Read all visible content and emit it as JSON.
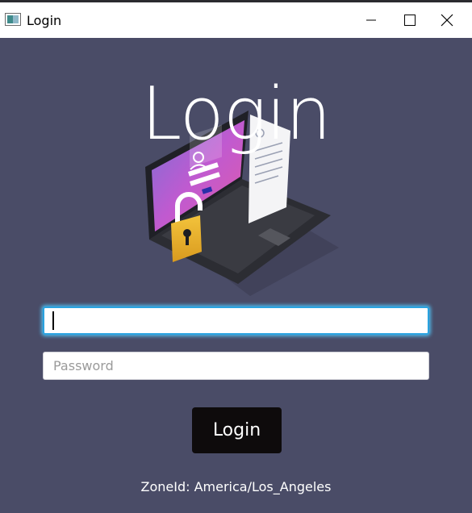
{
  "window": {
    "title": "Login",
    "controls": {
      "minimize": "minimize",
      "maximize": "maximize",
      "close": "close"
    }
  },
  "colors": {
    "background": "#4a4c67",
    "titlebar": "#ffffff",
    "button_bg": "#0e0b0c",
    "focus_border": "#2aa3e0"
  },
  "form": {
    "heading": "Login",
    "username": {
      "value": "",
      "placeholder": ""
    },
    "password": {
      "value": "",
      "placeholder": "Password"
    },
    "submit_label": "Login",
    "zone_text": "ZoneId: America/Los_Angeles"
  },
  "illustration": {
    "icon": "laptop-lock-illustration"
  }
}
